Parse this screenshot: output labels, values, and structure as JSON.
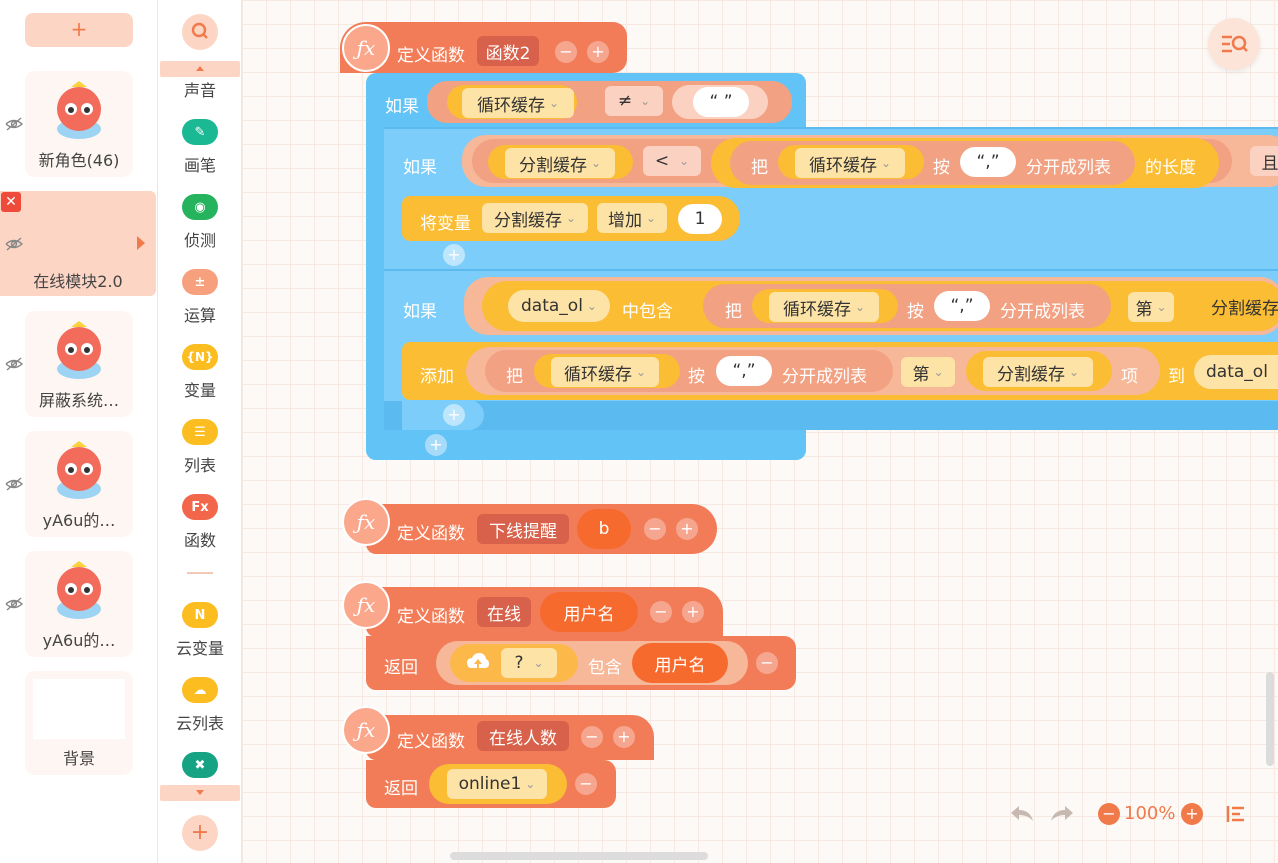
{
  "sprites": {
    "add_label": "+",
    "items": [
      {
        "name": "新角色(46)"
      },
      {
        "name": "在线模块2.0",
        "close": "✕"
      },
      {
        "name": "屏蔽系统…"
      },
      {
        "name": "yA6u的…"
      },
      {
        "name": "yA6u的…"
      },
      {
        "name": "背景"
      }
    ]
  },
  "categories": {
    "items": [
      {
        "label": "声音"
      },
      {
        "label": "画笔"
      },
      {
        "label": "侦测"
      },
      {
        "label": "运算"
      },
      {
        "label": "变量",
        "icon_text": "{N}"
      },
      {
        "label": "列表"
      },
      {
        "label": "函数",
        "icon_text": "Fx"
      },
      {
        "label": "云变量",
        "icon_text": "N"
      },
      {
        "label": "云列表"
      }
    ],
    "add_label": "+"
  },
  "blocks": {
    "def1": {
      "define": "定义函数",
      "name": "函数2",
      "minus": "−",
      "plus": "+"
    },
    "if1": {
      "kw": "如果",
      "var": "循环缓存",
      "op": "≠",
      "str": "“ ”"
    },
    "if2": {
      "kw": "如果",
      "var": "分割缓存",
      "op": "<",
      "ba": "把",
      "var2": "循环缓存",
      "an": "按",
      "sep": "“,”",
      "split": "分开成列表",
      "len": "的长度",
      "and": "且"
    },
    "change": {
      "kw": "将变量",
      "var": "分割缓存",
      "mode": "增加",
      "val": "1"
    },
    "if3": {
      "kw": "如果",
      "list": "data_ol",
      "contains": "中包含",
      "ba": "把",
      "var": "循环缓存",
      "an": "按",
      "sep": "“,”",
      "split": "分开成列表",
      "di": "第",
      "idx": "分割缓存"
    },
    "add": {
      "kw": "添加",
      "ba": "把",
      "var": "循环缓存",
      "an": "按",
      "sep": "“,”",
      "split": "分开成列表",
      "di": "第",
      "idx": "分割缓存",
      "xiang": "项",
      "to": "到",
      "list": "data_ol"
    },
    "add_plus": "+",
    "def2": {
      "define": "定义函数",
      "name": "下线提醒",
      "param": "b"
    },
    "def3": {
      "define": "定义函数",
      "name": "在线",
      "param": "用户名"
    },
    "ret3": {
      "kw": "返回",
      "cloud": "?",
      "contains": "包含",
      "param": "用户名"
    },
    "def4": {
      "define": "定义函数",
      "name": "在线人数"
    },
    "ret4": {
      "kw": "返回",
      "var": "online1"
    }
  },
  "toolbar": {
    "zoom": "100%",
    "zoom_out": "−",
    "zoom_in": "+"
  },
  "colors": {
    "func": "#f27c58",
    "control": "#62c3f7",
    "variable": "#fbbd33",
    "operator": "#f2a183",
    "cloud": "#fdb84a"
  }
}
